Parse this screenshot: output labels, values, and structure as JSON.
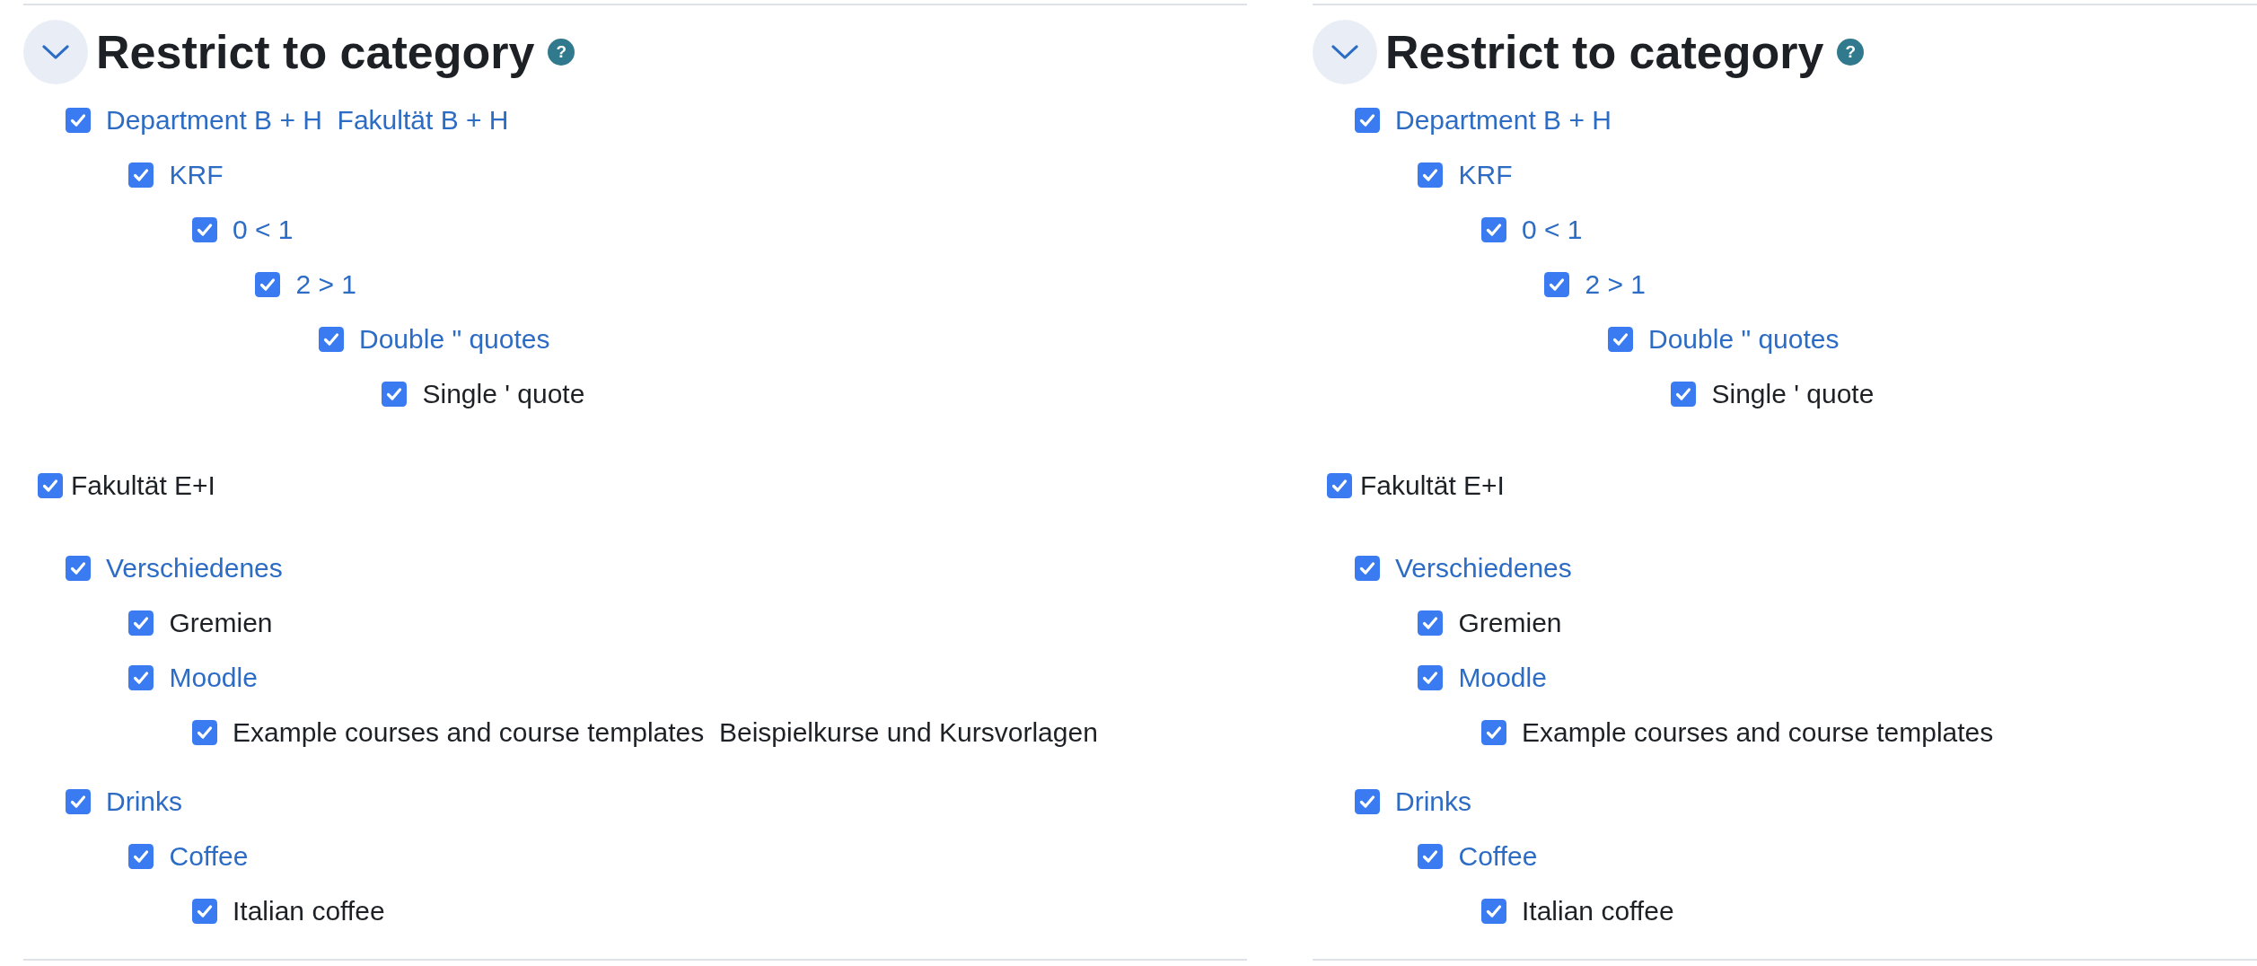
{
  "panels": [
    {
      "header": {
        "expanded": true,
        "title": "Restrict to category",
        "help": "?"
      },
      "categories": [
        {
          "kind": "branch",
          "label": "Department B + H  Fakultät B + H",
          "checked": true,
          "children": [
            {
              "kind": "branch",
              "label": "KRF",
              "checked": true,
              "children": [
                {
                  "kind": "branch",
                  "label": "0 < 1",
                  "checked": true,
                  "children": [
                    {
                      "kind": "branch",
                      "label": "2 > 1",
                      "checked": true,
                      "children": [
                        {
                          "kind": "branch",
                          "label": "Double \" quotes",
                          "checked": true,
                          "children": [
                            {
                              "kind": "leaf",
                              "label": "Single ' quote",
                              "checked": true
                            }
                          ]
                        }
                      ]
                    }
                  ]
                }
              ]
            }
          ]
        },
        {
          "kind": "standalone",
          "label": "Fakultät E+I",
          "checked": true
        },
        {
          "kind": "branch",
          "label": "Verschiedenes",
          "checked": true,
          "children": [
            {
              "kind": "leaf",
              "label": "Gremien",
              "checked": true
            },
            {
              "kind": "branch",
              "label": "Moodle",
              "checked": true,
              "children": [
                {
                  "kind": "leaf",
                  "label": "Example courses and course templates  Beispielkurse und Kursvorlagen",
                  "checked": true
                }
              ]
            }
          ]
        },
        {
          "kind": "branch",
          "label": "Drinks",
          "checked": true,
          "children": [
            {
              "kind": "branch",
              "label": "Coffee",
              "checked": true,
              "children": [
                {
                  "kind": "leaf",
                  "label": "Italian coffee",
                  "checked": true
                }
              ]
            }
          ]
        }
      ]
    },
    {
      "header": {
        "expanded": true,
        "title": "Restrict to category",
        "help": "?"
      },
      "categories": [
        {
          "kind": "branch",
          "label": "Department B + H",
          "checked": true,
          "children": [
            {
              "kind": "branch",
              "label": "KRF",
              "checked": true,
              "children": [
                {
                  "kind": "branch",
                  "label": "0 < 1",
                  "checked": true,
                  "children": [
                    {
                      "kind": "branch",
                      "label": "2 > 1",
                      "checked": true,
                      "children": [
                        {
                          "kind": "branch",
                          "label": "Double \" quotes",
                          "checked": true,
                          "children": [
                            {
                              "kind": "leaf",
                              "label": "Single ' quote",
                              "checked": true
                            }
                          ]
                        }
                      ]
                    }
                  ]
                }
              ]
            }
          ]
        },
        {
          "kind": "standalone",
          "label": "Fakultät E+I",
          "checked": true
        },
        {
          "kind": "branch",
          "label": "Verschiedenes",
          "checked": true,
          "children": [
            {
              "kind": "leaf",
              "label": "Gremien",
              "checked": true
            },
            {
              "kind": "branch",
              "label": "Moodle",
              "checked": true,
              "children": [
                {
                  "kind": "leaf",
                  "label": "Example courses and course templates",
                  "checked": true
                }
              ]
            }
          ]
        },
        {
          "kind": "branch",
          "label": "Drinks",
          "checked": true,
          "children": [
            {
              "kind": "branch",
              "label": "Coffee",
              "checked": true,
              "children": [
                {
                  "kind": "leaf",
                  "label": "Italian coffee",
                  "checked": true
                }
              ]
            }
          ]
        }
      ]
    }
  ]
}
